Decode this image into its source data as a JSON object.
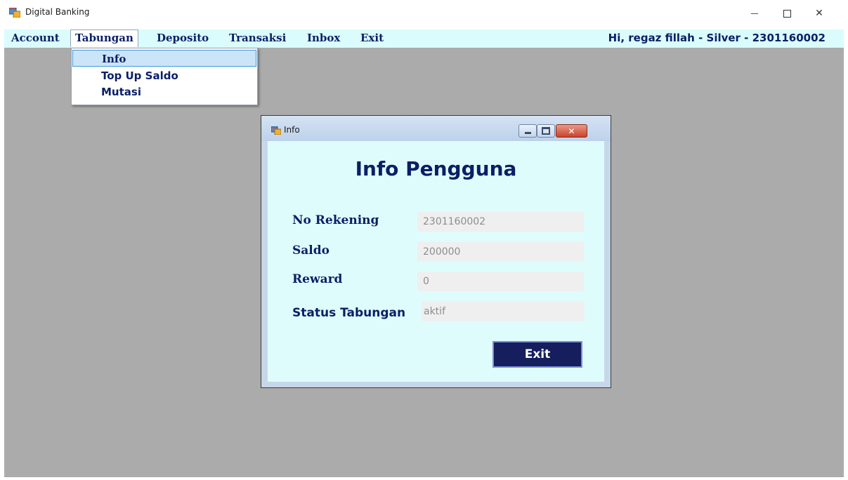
{
  "window": {
    "title": "Digital Banking",
    "controls": {
      "minimize": "—",
      "maximize": "☐",
      "close": "✕"
    }
  },
  "menubar": {
    "items": [
      {
        "label": "Account"
      },
      {
        "label": "Tabungan"
      },
      {
        "label": "Deposito"
      },
      {
        "label": "Transaksi"
      },
      {
        "label": "Inbox"
      },
      {
        "label": "Exit"
      }
    ],
    "open_menu": "Tabungan",
    "greeting": "Hi, regaz fillah - Silver - 2301160002"
  },
  "dropdown": {
    "items": [
      {
        "label": "Info",
        "highlighted": true
      },
      {
        "label": "Top Up Saldo",
        "highlighted": false
      },
      {
        "label": "Mutasi",
        "highlighted": false
      }
    ]
  },
  "info_dialog": {
    "title": "Info",
    "heading": "Info Pengguna",
    "fields": [
      {
        "label": "No Rekening",
        "value": "2301160002"
      },
      {
        "label": "Saldo",
        "value": "200000"
      },
      {
        "label": "Reward",
        "value": "0"
      },
      {
        "label": "Status Tabungan",
        "value": "aktif"
      }
    ],
    "exit_label": "Exit"
  },
  "colors": {
    "menubar_bg": "#dafcfc",
    "menu_text": "#0a1f66",
    "workspace_bg": "#ababab",
    "dialog_body_bg": "#dffcfc",
    "exit_button_bg": "#161e5e",
    "field_bg": "#efefef"
  },
  "icons": {
    "app": "app-window-icon",
    "dialog": "app-window-icon"
  }
}
